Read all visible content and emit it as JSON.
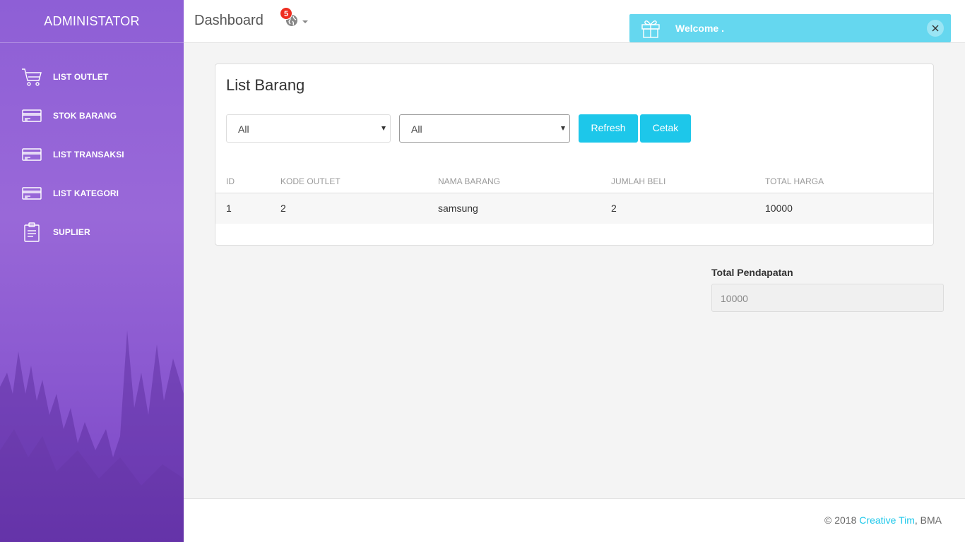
{
  "sidebar": {
    "brand": "ADMINISTATOR",
    "items": [
      {
        "label": "LIST OUTLET",
        "icon": "cart-icon"
      },
      {
        "label": "STOK BARANG",
        "icon": "credit-card-icon"
      },
      {
        "label": "LIST TRANSAKSI",
        "icon": "credit-card-icon"
      },
      {
        "label": "LIST KATEGORI",
        "icon": "credit-card-icon"
      },
      {
        "label": "SUPLIER",
        "icon": "clipboard-icon"
      }
    ]
  },
  "header": {
    "title": "Dashboard",
    "notification_count": "5",
    "notification_icon": "globe-icon"
  },
  "notification": {
    "message": "Welcome .",
    "icon": "gift-icon",
    "color": "#65d7ef"
  },
  "card": {
    "title": "List Barang",
    "filter1": "All",
    "filter2": "All",
    "refresh_label": "Refresh",
    "print_label": "Cetak",
    "columns": [
      "ID",
      "KODE OUTLET",
      "NAMA BARANG",
      "JUMLAH BELI",
      "TOTAL HARGA"
    ],
    "rows": [
      [
        "1",
        "2",
        "samsung",
        "2",
        "10000"
      ]
    ]
  },
  "total": {
    "label": "Total Pendapatan",
    "value": "10000"
  },
  "footer": {
    "prefix": "© 2018 ",
    "link": "Creative Tim",
    "suffix": ", BMA"
  },
  "colors": {
    "accent": "#1dc7ea",
    "sidebar": "#8e5fd6",
    "badge": "#ee2d20"
  }
}
